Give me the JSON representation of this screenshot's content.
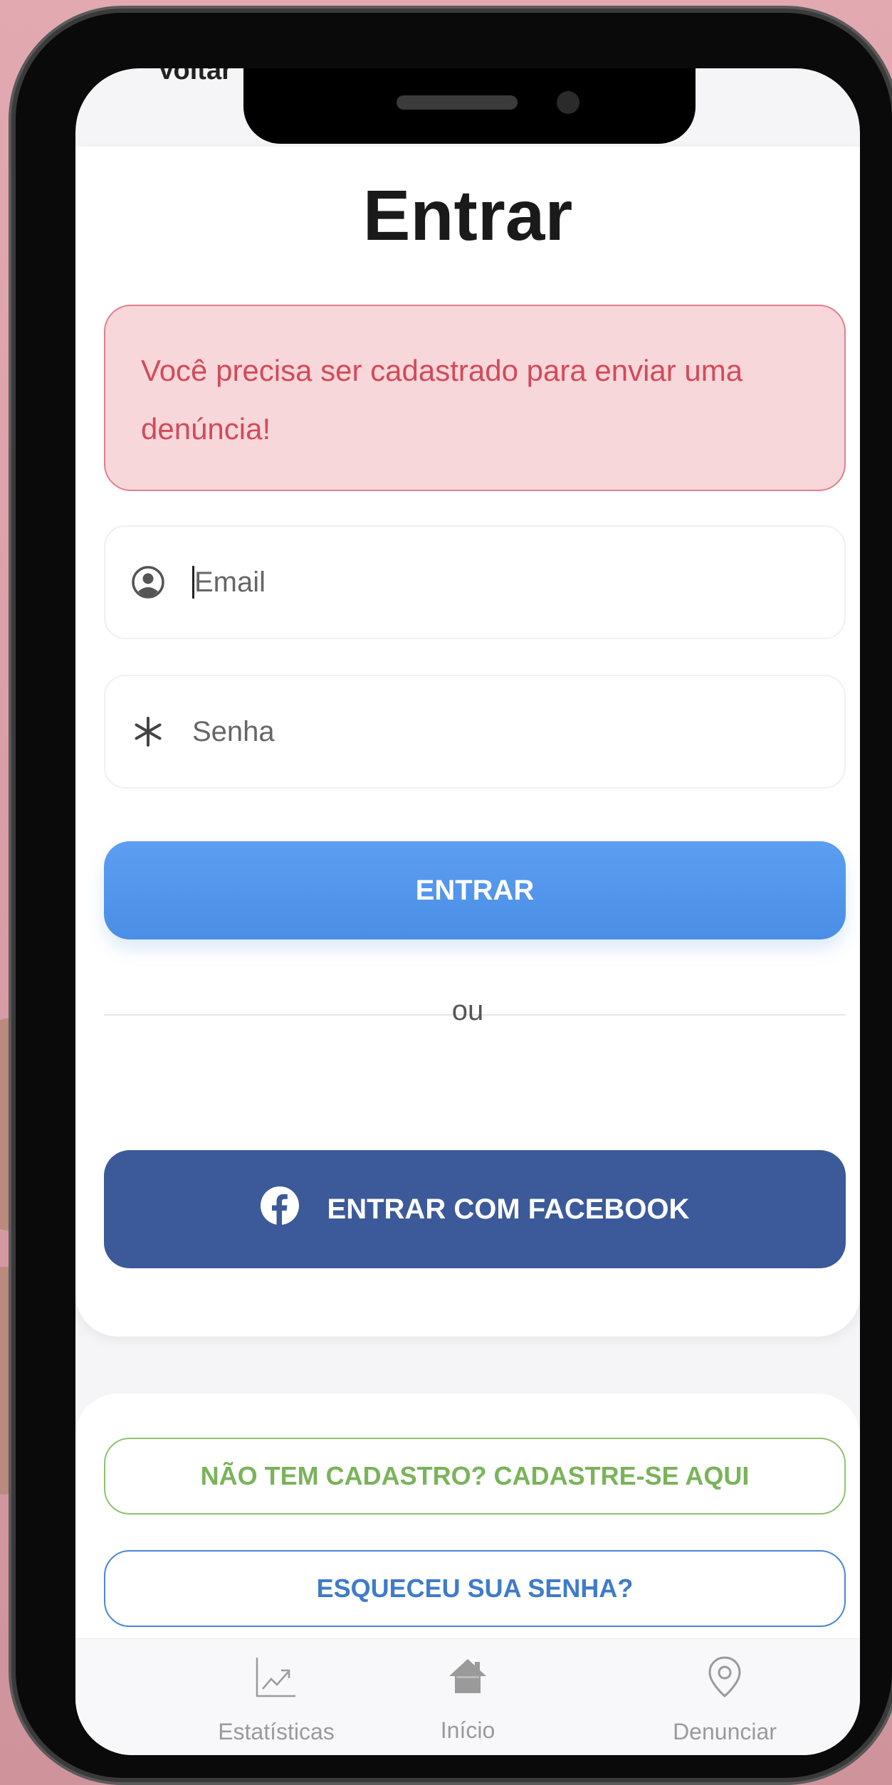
{
  "header": {
    "back_label": "Voltar"
  },
  "login": {
    "title": "Entrar",
    "alert_message": "Você precisa ser cadastrado para enviar uma denúncia!",
    "email_placeholder": "Email",
    "password_placeholder": "Senha",
    "submit_label": "ENTRAR",
    "separator": "ou",
    "facebook_label": "ENTRAR COM FACEBOOK"
  },
  "secondary": {
    "register_label": "NÃO TEM CADASTRO? CADASTRE-SE AQUI",
    "forgot_label": "ESQUECEU SUA SENHA?"
  },
  "tabbar": {
    "items": [
      {
        "label": "Estatísticas",
        "icon": "chart-icon"
      },
      {
        "label": "Início",
        "icon": "home-icon"
      },
      {
        "label": "Denunciar",
        "icon": "location-pin-icon"
      }
    ]
  },
  "colors": {
    "primary": "#4a8ee6",
    "facebook": "#3c5a99",
    "alert_bg": "#f8d7da",
    "alert_text": "#d24a5a",
    "register": "#7ab35a",
    "forgot": "#3f7bc9"
  }
}
